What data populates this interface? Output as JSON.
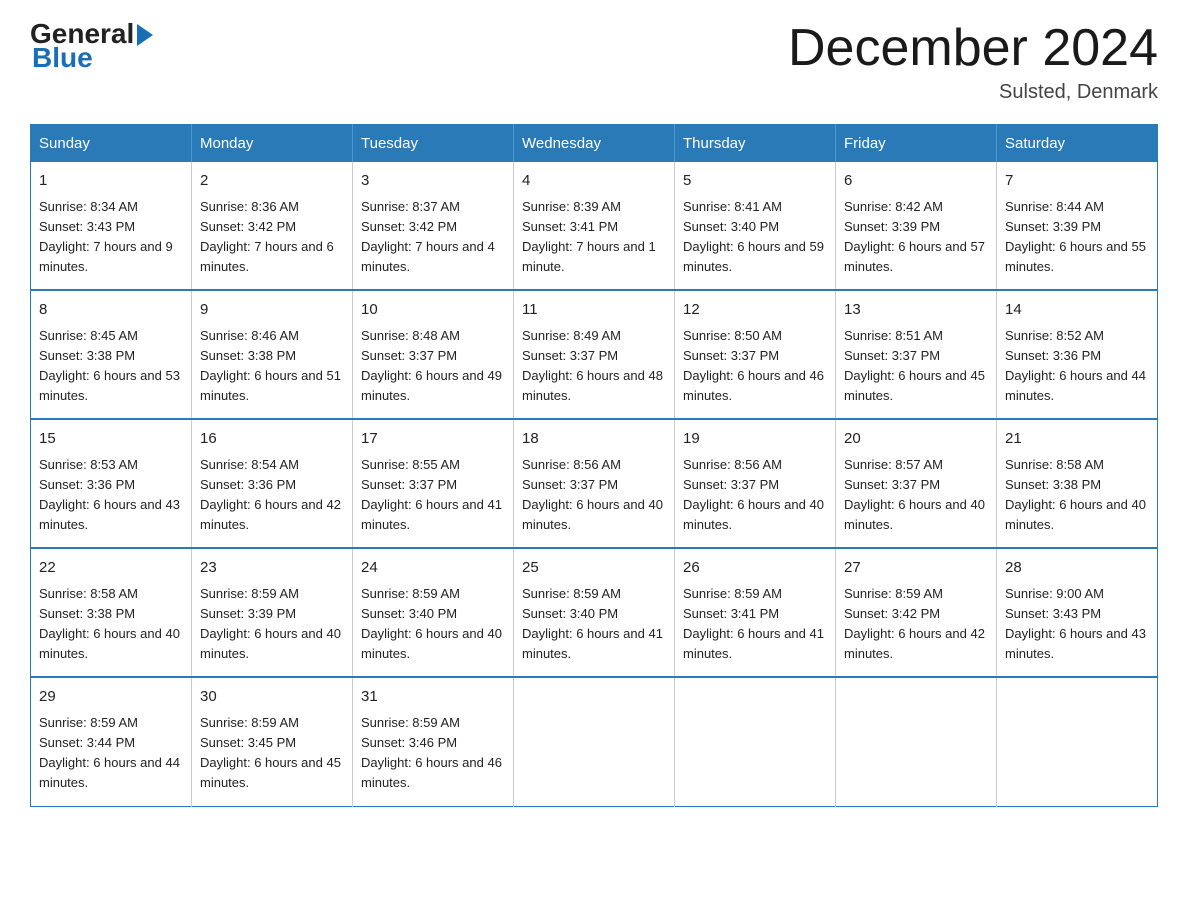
{
  "header": {
    "title": "December 2024",
    "location": "Sulsted, Denmark",
    "logo_general": "General",
    "logo_blue": "Blue"
  },
  "weekdays": [
    "Sunday",
    "Monday",
    "Tuesday",
    "Wednesday",
    "Thursday",
    "Friday",
    "Saturday"
  ],
  "weeks": [
    [
      {
        "day": "1",
        "sunrise": "8:34 AM",
        "sunset": "3:43 PM",
        "daylight": "7 hours and 9 minutes."
      },
      {
        "day": "2",
        "sunrise": "8:36 AM",
        "sunset": "3:42 PM",
        "daylight": "7 hours and 6 minutes."
      },
      {
        "day": "3",
        "sunrise": "8:37 AM",
        "sunset": "3:42 PM",
        "daylight": "7 hours and 4 minutes."
      },
      {
        "day": "4",
        "sunrise": "8:39 AM",
        "sunset": "3:41 PM",
        "daylight": "7 hours and 1 minute."
      },
      {
        "day": "5",
        "sunrise": "8:41 AM",
        "sunset": "3:40 PM",
        "daylight": "6 hours and 59 minutes."
      },
      {
        "day": "6",
        "sunrise": "8:42 AM",
        "sunset": "3:39 PM",
        "daylight": "6 hours and 57 minutes."
      },
      {
        "day": "7",
        "sunrise": "8:44 AM",
        "sunset": "3:39 PM",
        "daylight": "6 hours and 55 minutes."
      }
    ],
    [
      {
        "day": "8",
        "sunrise": "8:45 AM",
        "sunset": "3:38 PM",
        "daylight": "6 hours and 53 minutes."
      },
      {
        "day": "9",
        "sunrise": "8:46 AM",
        "sunset": "3:38 PM",
        "daylight": "6 hours and 51 minutes."
      },
      {
        "day": "10",
        "sunrise": "8:48 AM",
        "sunset": "3:37 PM",
        "daylight": "6 hours and 49 minutes."
      },
      {
        "day": "11",
        "sunrise": "8:49 AM",
        "sunset": "3:37 PM",
        "daylight": "6 hours and 48 minutes."
      },
      {
        "day": "12",
        "sunrise": "8:50 AM",
        "sunset": "3:37 PM",
        "daylight": "6 hours and 46 minutes."
      },
      {
        "day": "13",
        "sunrise": "8:51 AM",
        "sunset": "3:37 PM",
        "daylight": "6 hours and 45 minutes."
      },
      {
        "day": "14",
        "sunrise": "8:52 AM",
        "sunset": "3:36 PM",
        "daylight": "6 hours and 44 minutes."
      }
    ],
    [
      {
        "day": "15",
        "sunrise": "8:53 AM",
        "sunset": "3:36 PM",
        "daylight": "6 hours and 43 minutes."
      },
      {
        "day": "16",
        "sunrise": "8:54 AM",
        "sunset": "3:36 PM",
        "daylight": "6 hours and 42 minutes."
      },
      {
        "day": "17",
        "sunrise": "8:55 AM",
        "sunset": "3:37 PM",
        "daylight": "6 hours and 41 minutes."
      },
      {
        "day": "18",
        "sunrise": "8:56 AM",
        "sunset": "3:37 PM",
        "daylight": "6 hours and 40 minutes."
      },
      {
        "day": "19",
        "sunrise": "8:56 AM",
        "sunset": "3:37 PM",
        "daylight": "6 hours and 40 minutes."
      },
      {
        "day": "20",
        "sunrise": "8:57 AM",
        "sunset": "3:37 PM",
        "daylight": "6 hours and 40 minutes."
      },
      {
        "day": "21",
        "sunrise": "8:58 AM",
        "sunset": "3:38 PM",
        "daylight": "6 hours and 40 minutes."
      }
    ],
    [
      {
        "day": "22",
        "sunrise": "8:58 AM",
        "sunset": "3:38 PM",
        "daylight": "6 hours and 40 minutes."
      },
      {
        "day": "23",
        "sunrise": "8:59 AM",
        "sunset": "3:39 PM",
        "daylight": "6 hours and 40 minutes."
      },
      {
        "day": "24",
        "sunrise": "8:59 AM",
        "sunset": "3:40 PM",
        "daylight": "6 hours and 40 minutes."
      },
      {
        "day": "25",
        "sunrise": "8:59 AM",
        "sunset": "3:40 PM",
        "daylight": "6 hours and 41 minutes."
      },
      {
        "day": "26",
        "sunrise": "8:59 AM",
        "sunset": "3:41 PM",
        "daylight": "6 hours and 41 minutes."
      },
      {
        "day": "27",
        "sunrise": "8:59 AM",
        "sunset": "3:42 PM",
        "daylight": "6 hours and 42 minutes."
      },
      {
        "day": "28",
        "sunrise": "9:00 AM",
        "sunset": "3:43 PM",
        "daylight": "6 hours and 43 minutes."
      }
    ],
    [
      {
        "day": "29",
        "sunrise": "8:59 AM",
        "sunset": "3:44 PM",
        "daylight": "6 hours and 44 minutes."
      },
      {
        "day": "30",
        "sunrise": "8:59 AM",
        "sunset": "3:45 PM",
        "daylight": "6 hours and 45 minutes."
      },
      {
        "day": "31",
        "sunrise": "8:59 AM",
        "sunset": "3:46 PM",
        "daylight": "6 hours and 46 minutes."
      },
      null,
      null,
      null,
      null
    ]
  ]
}
